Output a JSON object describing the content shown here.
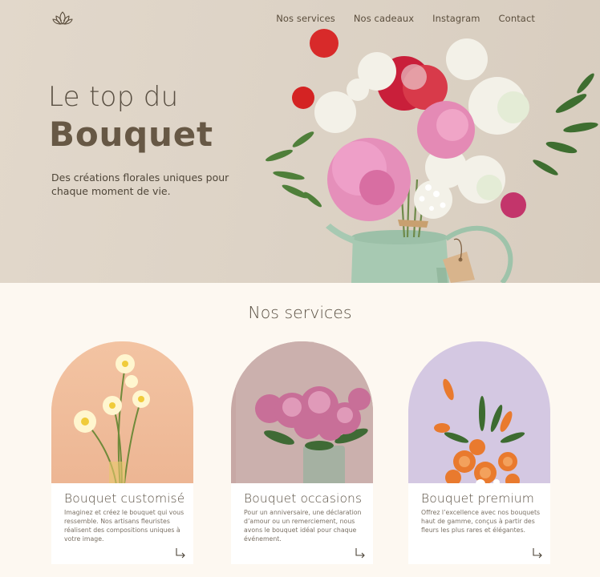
{
  "nav": [
    "Nos services",
    "Nos cadeaux",
    "Instagram",
    "Contact"
  ],
  "hero": {
    "title_line1": "Le top du",
    "title_line2": "Bouquet",
    "subtitle": "Des créations florales uniques pour chaque moment de vie."
  },
  "services": {
    "title": "Nos services",
    "cards": [
      {
        "title": "Bouquet customisé",
        "text": "Imaginez et créez le bouquet qui vous ressemble. Nos artisans fleuristes réalisent des compositions uniques à votre image."
      },
      {
        "title": "Bouquet occasions",
        "text": "Pour un anniversaire, une déclaration d’amour ou un remerciement, nous avons le bouquet idéal pour chaque événement."
      },
      {
        "title": "Bouquet premium",
        "text": "Offrez l’excellence avec nos bouquets haut de gamme, conçus à partir des fleurs les plus rares et élégantes."
      }
    ]
  },
  "icons": {
    "logo": "lotus-icon",
    "card_link": "arrow-down-right-icon"
  },
  "colors": {
    "hero_bg": "#ddd3c6",
    "page_bg": "#fdf8f1",
    "heading": "#675845",
    "card1_bg": "#f0bf9c",
    "card2_bg": "#c9aba9",
    "card3_bg": "#d4c9e3"
  }
}
